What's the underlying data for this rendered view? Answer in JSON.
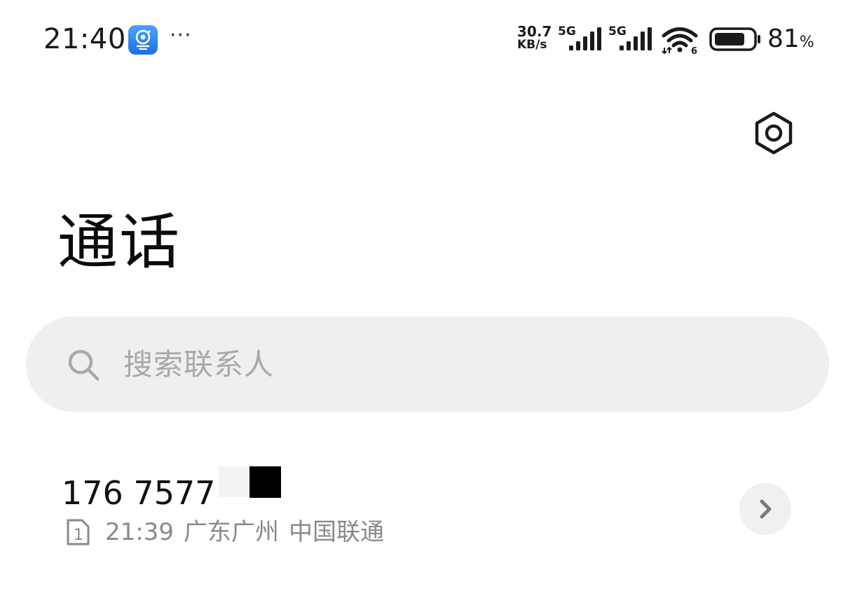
{
  "status_bar": {
    "time": "21:40",
    "more": "···",
    "net_speed_value": "30.7",
    "net_speed_unit": "KB/s",
    "sim1_network": "5G",
    "sim2_network": "5G",
    "wifi_label": "6",
    "battery_level": 0.81,
    "battery_percent": "81",
    "battery_percent_sign": "%"
  },
  "header": {
    "title": "通话"
  },
  "search": {
    "placeholder": "搜索联系人"
  },
  "calls": [
    {
      "number": "176 7577",
      "sim_slot": "1",
      "time": "21:39",
      "location": "广东广州",
      "carrier": "中国联通"
    }
  ],
  "colors": {
    "background": "#ffffff",
    "search_bg": "#efefef",
    "placeholder": "#a9a9a9",
    "secondary_text": "#8a8a8a",
    "app_icon_blue": "#2f8cf0"
  },
  "icons": {
    "status_app": "camera-app-icon",
    "settings": "hexagon-gear-icon",
    "search": "magnifier-icon",
    "sim": "sim-card-icon",
    "detail": "chevron-right-icon"
  }
}
